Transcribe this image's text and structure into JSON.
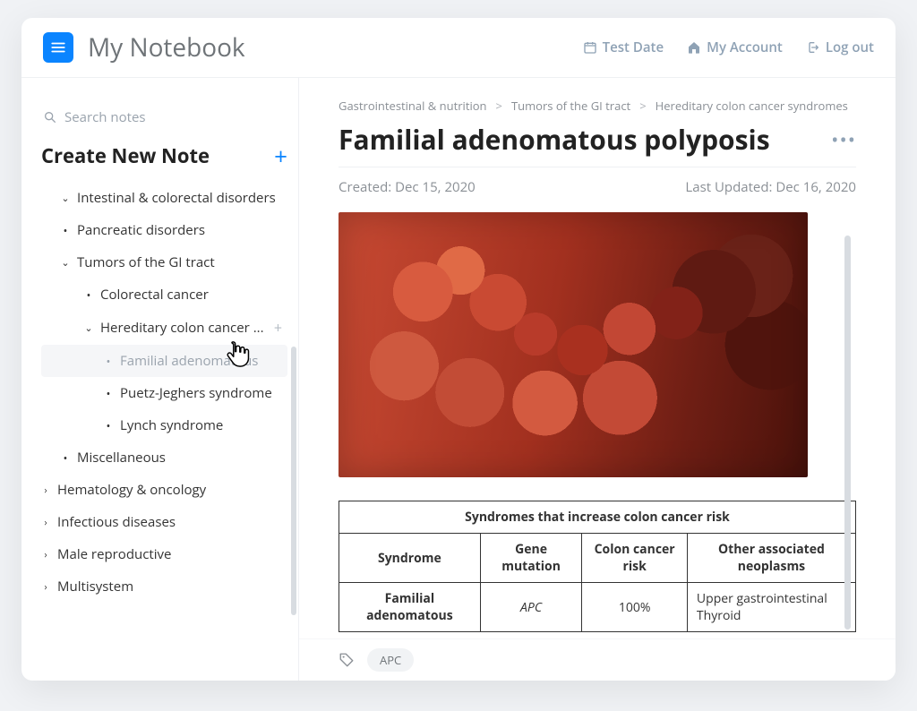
{
  "header": {
    "app_title": "My Notebook",
    "links": {
      "test_date": "Test Date",
      "account": "My Account",
      "logout": "Log out"
    }
  },
  "sidebar": {
    "search_placeholder": "Search notes",
    "create_label": "Create New Note",
    "tree": {
      "intestinal": "Intestinal & colorectal disorders",
      "pancreatic": "Pancreatic disorders",
      "tumors": "Tumors of the GI tract",
      "colorectal": "Colorectal cancer",
      "hereditary": "Hereditary colon cancer ...",
      "familial": "Familial adenomatous",
      "puetz": "Puetz-Jeghers syndrome",
      "lynch": "Lynch syndrome",
      "misc": "Miscellaneous",
      "hematology": "Hematology & oncology",
      "infectious": "Infectious diseases",
      "male_repro": "Male reproductive",
      "multisystem": "Multisystem"
    }
  },
  "main": {
    "breadcrumb": {
      "a": "Gastrointestinal & nutrition",
      "b": "Tumors of the GI tract",
      "c": "Hereditary colon cancer syndromes"
    },
    "title": "Familial adenomatous polyposis",
    "created": "Created: Dec 15, 2020",
    "updated": "Last Updated: Dec 16, 2020",
    "table": {
      "caption": "Syndromes that increase colon cancer risk",
      "headers": {
        "syndrome": "Syndrome",
        "gene": "Gene mutation",
        "risk": "Colon cancer risk",
        "other": "Other associated neoplasms"
      },
      "row1": {
        "syndrome": "Familial adenomatous",
        "gene": "APC",
        "risk": "100%",
        "other1": "Upper gastrointestinal",
        "other2": "Thyroid"
      }
    },
    "tag": "APC"
  }
}
